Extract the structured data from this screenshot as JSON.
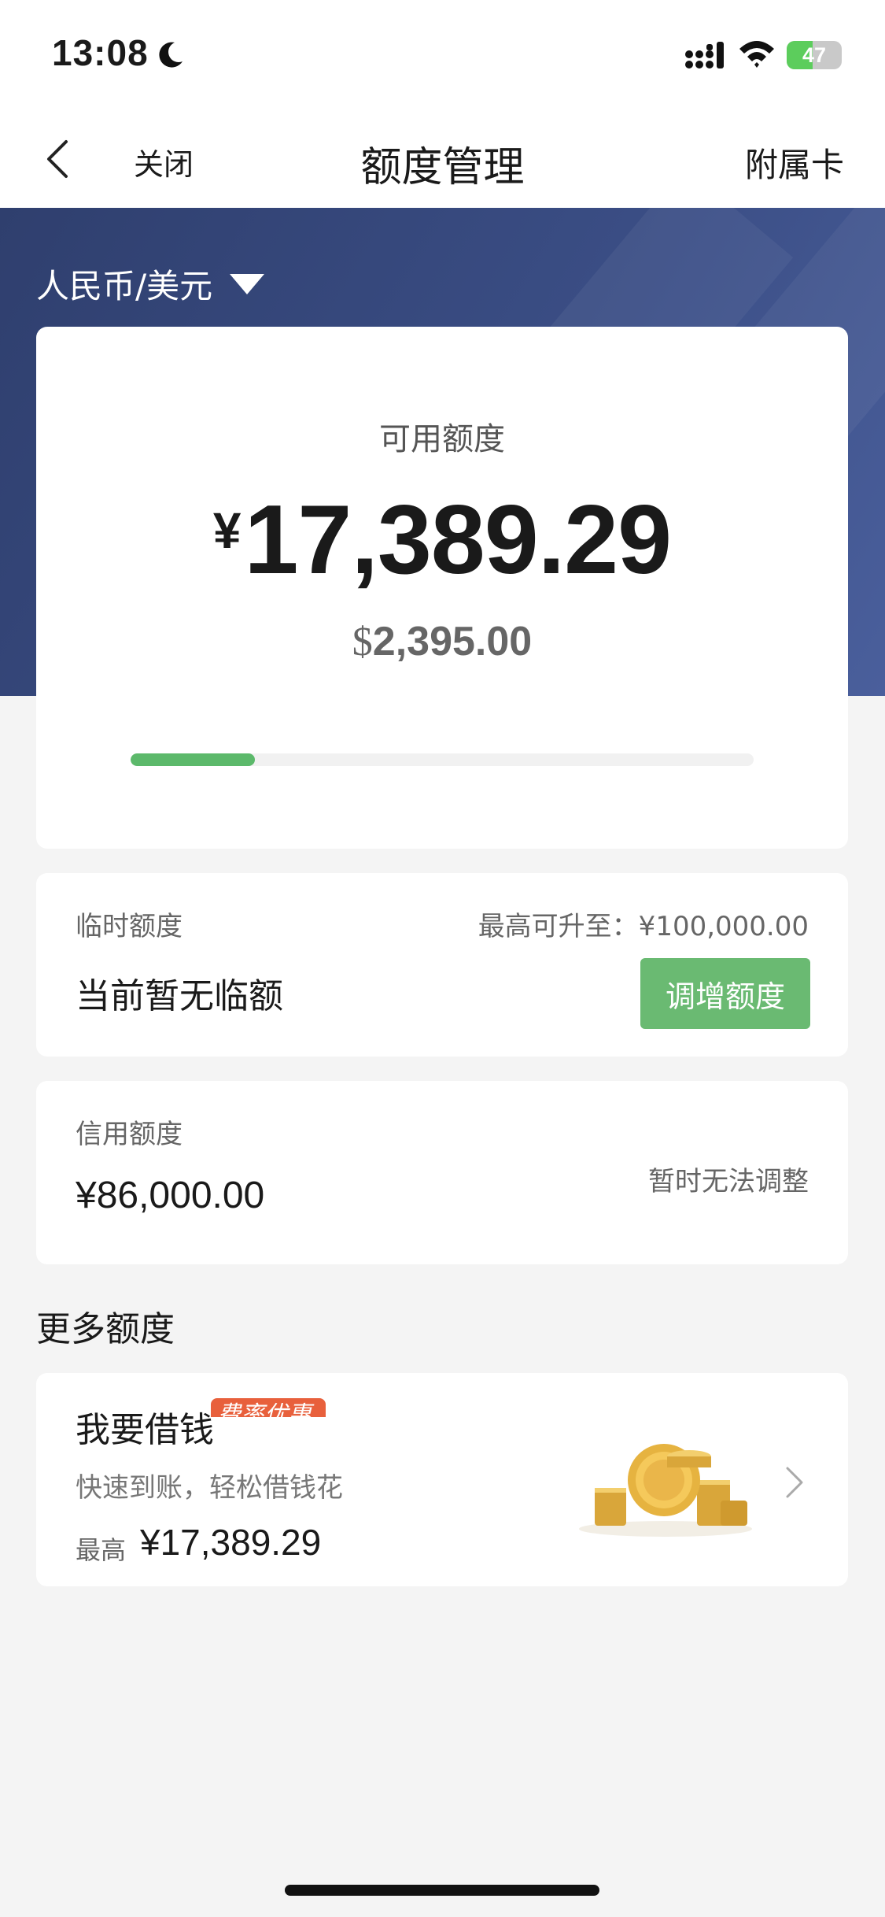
{
  "status_bar": {
    "time": "13:08",
    "battery": "47",
    "icons": [
      "moon-icon",
      "signal-icon",
      "wifi-icon",
      "battery-icon"
    ]
  },
  "nav": {
    "close": "关闭",
    "title": "额度管理",
    "right": "附属卡"
  },
  "banner": {
    "currency": "人民币/美元"
  },
  "available": {
    "label": "可用额度",
    "cny_symbol": "¥",
    "cny_amount": "17,389.29",
    "usd_symbol": "$",
    "usd_amount": "2,395.00",
    "used_fraction": 0.2,
    "progress_color": "#5cb96b"
  },
  "temporary": {
    "label": "临时额度",
    "max": "最高可升至：¥100,000.00",
    "status": "当前暂无临额",
    "button": "调增额度",
    "button_color": "#6aba72"
  },
  "credit": {
    "label": "信用额度",
    "value": "¥86,000.00",
    "note": "暂时无法调整"
  },
  "more": {
    "title": "更多额度"
  },
  "loan": {
    "title": "我要借钱",
    "badge": "费率优惠",
    "badge_color": "#e8603c",
    "desc": "快速到账，轻松借钱花",
    "max_label": "最高",
    "max_value": "¥17,389.29"
  }
}
